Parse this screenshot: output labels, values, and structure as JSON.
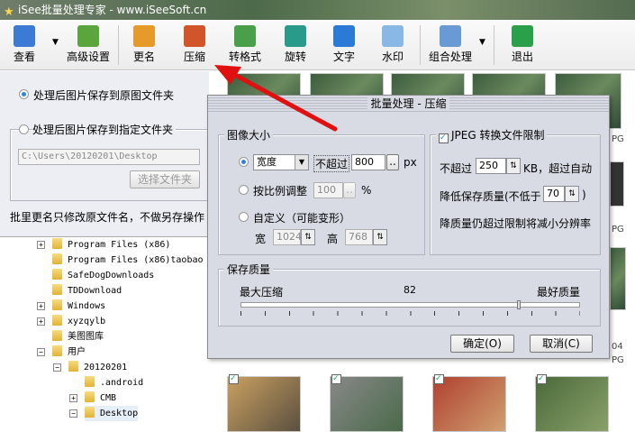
{
  "window": {
    "title": "iSee批量处理专家 - www.iSeeSoft.cn"
  },
  "toolbar": [
    {
      "label": "查看",
      "icon": "view-icon",
      "color": "#3b7bd6"
    },
    {
      "label": "高级设置",
      "icon": "advanced-settings-icon",
      "color": "#5aa63c"
    },
    {
      "label": "更名",
      "icon": "rename-icon",
      "color": "#e59a2a"
    },
    {
      "label": "压缩",
      "icon": "compress-icon",
      "color": "#d2542a"
    },
    {
      "label": "转格式",
      "icon": "convert-format-icon",
      "color": "#4aa04a"
    },
    {
      "label": "旋转",
      "icon": "rotate-icon",
      "color": "#2a9a8a"
    },
    {
      "label": "文字",
      "icon": "text-icon",
      "color": "#2a7ad6"
    },
    {
      "label": "水印",
      "icon": "watermark-icon",
      "color": "#8ab8e6"
    },
    {
      "label": "组合处理",
      "icon": "combo-process-icon",
      "color": "#6a9ad6"
    },
    {
      "label": "退出",
      "icon": "exit-icon",
      "color": "#2aa04a"
    }
  ],
  "left": {
    "save_original": "处理后图片保存到原图文件夹",
    "save_specified": "处理后图片保存到指定文件夹",
    "path": "C:\\Users\\20120201\\Desktop",
    "choose_folder": "选择文件夹",
    "note": "批里更名只修改原文件名，不做另存操作"
  },
  "tree": [
    "Program Files (x86)",
    "Program Files (x86)taobao",
    "SafeDogDownloads",
    "TDDownload",
    "Windows",
    "xyzqylb",
    "美图图库",
    "用户",
    "20120201",
    ".android",
    "CMB",
    "Desktop"
  ],
  "thumb_labels": [
    "PG",
    "PG",
    "04",
    "PG"
  ],
  "dialog": {
    "title": "批量处理 - 压缩",
    "size_group": "图像大小",
    "dim_select": "宽度",
    "not_exceed": "不超过",
    "dim_value": "800",
    "ellipsis": "..",
    "px": "px",
    "scale_label": "按比例调整",
    "scale_value": "100",
    "percent": "%",
    "custom_label": "自定义（可能变形）",
    "width_label": "宽",
    "width_value": "1024",
    "height_label": "高",
    "height_value": "768",
    "jpeg_group": "JPEG 转换文件限制",
    "jpeg_checked": true,
    "limit_prefix": "不超过",
    "limit_value": "250",
    "limit_suffix": "KB，超过自动",
    "lower_quality": "降低保存质量(不低于",
    "min_quality": "70",
    "close_paren": ")",
    "reduce_res": "降质量仍超过限制将减小分辨率",
    "quality_group": "保存质量",
    "max_compress": "最大压缩",
    "quality_value": "82",
    "best_quality": "最好质量",
    "ok": "确定(O)",
    "cancel": "取消(C)"
  }
}
